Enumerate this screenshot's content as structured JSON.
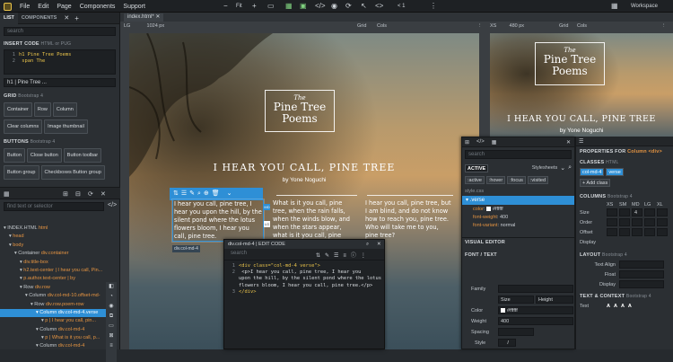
{
  "menubar": {
    "items": [
      "File",
      "Edit",
      "Page",
      "Components",
      "Support"
    ],
    "zoom": "Fit",
    "undo_count": "< 1",
    "workspace": "Workspace"
  },
  "left": {
    "tabs": [
      "LIST",
      "COMPONENTS"
    ],
    "search_placeholder": "search",
    "insert_code": {
      "title": "INSERT CODE",
      "sub": "HTML or PUG",
      "lines": [
        "h1 Pine Tree Poems",
        "  span The"
      ],
      "gutter": [
        "1",
        "2"
      ]
    },
    "selected_snippet": "h1 | Pine Tree ...",
    "grid": {
      "title": "GRID",
      "sub": "Bootstrap 4",
      "buttons": [
        "Container",
        "Row",
        "Column",
        "Clear columns",
        "Image thumbnail"
      ]
    },
    "buttons": {
      "title": "BUTTONS",
      "sub": "Bootstrap 4",
      "buttons": [
        "Button",
        "Close button",
        "Button toolbar",
        "Button group",
        "Checkboxes Button group"
      ]
    },
    "tree_search_placeholder": "find text or selector",
    "tree": [
      {
        "label": "INDEX.HTML",
        "tag": "html",
        "indent": 0
      },
      {
        "label": "",
        "tag": "head",
        "indent": 1
      },
      {
        "label": "",
        "tag": "body",
        "indent": 1
      },
      {
        "label": "Container",
        "tag": "div.container",
        "indent": 2
      },
      {
        "label": "",
        "tag": "div.title-box",
        "indent": 3
      },
      {
        "label": "",
        "tag": "h2.text-center | I hear you call, Pin...",
        "indent": 3
      },
      {
        "label": "",
        "tag": "p.author.text-center | by",
        "indent": 3
      },
      {
        "label": "Row",
        "tag": "div.row",
        "indent": 3
      },
      {
        "label": "Column",
        "tag": "div.col-md-10.offset-md-",
        "indent": 4
      },
      {
        "label": "Row",
        "tag": "div.row.poem-row",
        "indent": 5
      },
      {
        "label": "Column",
        "tag": "div.col-md-4.verse",
        "indent": 6,
        "selected": true
      },
      {
        "label": "",
        "tag": "p | I hear you call, pin...",
        "indent": 7
      },
      {
        "label": "Column",
        "tag": "div.col-md-4",
        "indent": 6
      },
      {
        "label": "",
        "tag": "p | What is it you call, p...",
        "indent": 7
      },
      {
        "label": "Column",
        "tag": "div.col-md-4",
        "indent": 6
      }
    ]
  },
  "canvas": {
    "file_tab": "index.html*",
    "lg_view": {
      "size": "LG",
      "width": "1024 px",
      "grid": "Grid",
      "cols": "Cols"
    },
    "xs_view": {
      "size": "XS",
      "width": "480 px",
      "grid": "Grid",
      "cols": "Cols"
    },
    "logo": {
      "the": "The",
      "line1": "Pine Tree",
      "line2": "Poems"
    },
    "heading": "I HEAR YOU CALL, PINE TREE",
    "author": "by Yone Noguchi",
    "verses": [
      "I hear you call, pine tree, I hear you upon the hill, by the silent pond where the lotus flowers bloom, I hear you call, pine tree.",
      "What is it you call, pine tree, when the rain falls, when the winds blow, and when the stars appear, what is it you call, pine tree?",
      "I hear you call, pine tree, but I am blind, and do not know how to reach you, pine tree. Who will take me to you, pine tree?"
    ],
    "element_label": "div.col-md-4",
    "xs_heading": "I HEAR YOU CALL, PINE TREE",
    "xs_author": "by Yone Noguchi"
  },
  "code_panel": {
    "title": "div.col-md-4 | EDIT CODE",
    "search_placeholder": "search",
    "gutter": [
      "1",
      "2",
      "3"
    ],
    "lines": [
      "<div class=\"col-md-4 verse\">",
      "    <p>I hear you call, pine tree, I hear you",
      "upon the hill, by the silent pond where the lotus",
      "flowers bloom, I hear you call, pine tree.</p>",
      "</div>"
    ]
  },
  "style_panel": {
    "search_placeholder": "search",
    "active_tab": "ACTIVE",
    "stylesheets_label": "Stylesheets",
    "states": [
      ":active",
      ":hover",
      ":focus",
      ":visited"
    ],
    "style_css": "style.css",
    "rule": ".verse",
    "props": [
      {
        "name": "color",
        "value": "#ffffff"
      },
      {
        "name": "font-weight",
        "value": "400"
      },
      {
        "name": "font-variant",
        "value": "normal"
      }
    ],
    "visual_editor": "VISUAL EDITOR",
    "font_title": "FONT / TEXT",
    "family_label": "Family",
    "size_label": "Size",
    "height_label": "Height",
    "color_label": "Color",
    "color_value": "#ffffff",
    "weight_label": "Weight",
    "weight_value": "400",
    "spacing_label": "Spacing",
    "style_label": "Style",
    "style_value": "I"
  },
  "props_panel": {
    "title": "PROPERTIES FOR",
    "title_el": "Column <div>",
    "classes_title": "CLASSES",
    "classes_sub": "HTML",
    "classes": [
      "col-md-4",
      "verse"
    ],
    "add_class": "+ Add class",
    "columns_title": "COLUMNS",
    "columns_sub": "Bootstrap 4",
    "col_headers": [
      "XS",
      "SM",
      "MD",
      "LG",
      "XL"
    ],
    "rows": [
      "Size",
      "Order",
      "Offset"
    ],
    "md_size": "4",
    "display_label": "Display",
    "layout_title": "LAYOUT",
    "layout_sub": "Bootstrap 4",
    "text_align": "Text Align",
    "float": "Float",
    "display2": "Display",
    "text_context_title": "TEXT & CONTEXT",
    "text_context_sub": "Bootstrap 4",
    "text_label": "Text"
  },
  "colors": {
    "accent": "#2e8fd6",
    "tag": "#e59442",
    "panel": "#2b2f33",
    "dark": "#1e2124"
  }
}
